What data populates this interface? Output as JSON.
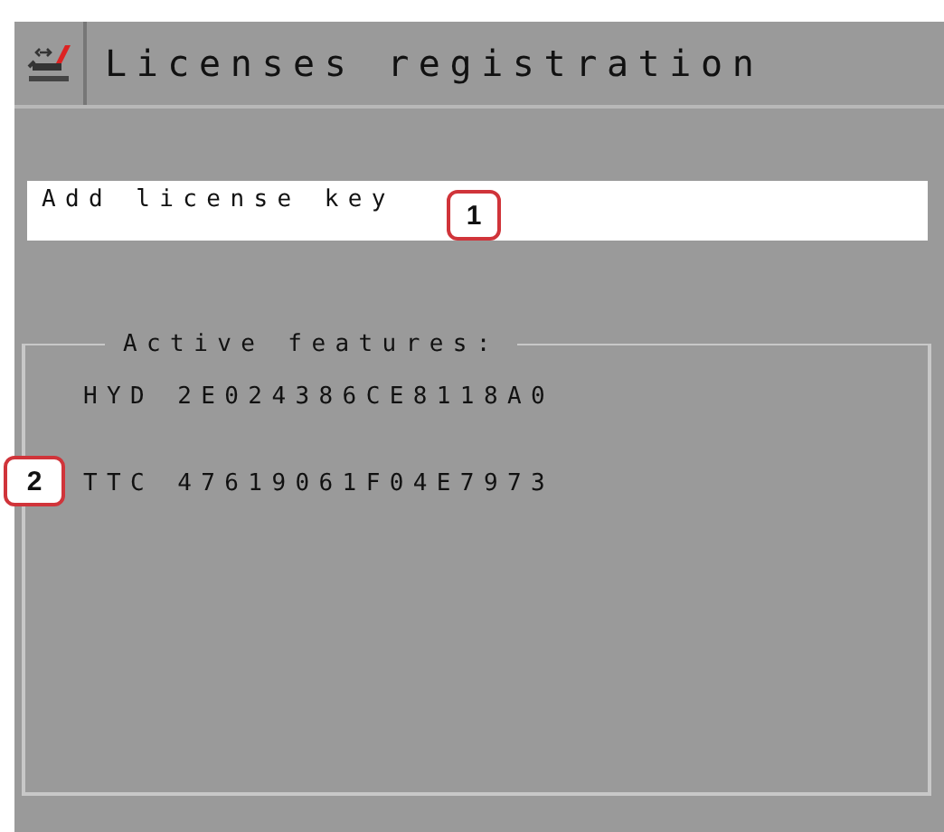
{
  "header": {
    "title": "Licenses registration"
  },
  "license_field": {
    "placeholder": "Add license key"
  },
  "features": {
    "title": "Active features:",
    "items": [
      "HYD 2E024386CE8118A0",
      "TTC 47619061F04E7973"
    ]
  },
  "callouts": [
    {
      "label": "1"
    },
    {
      "label": "2"
    }
  ]
}
